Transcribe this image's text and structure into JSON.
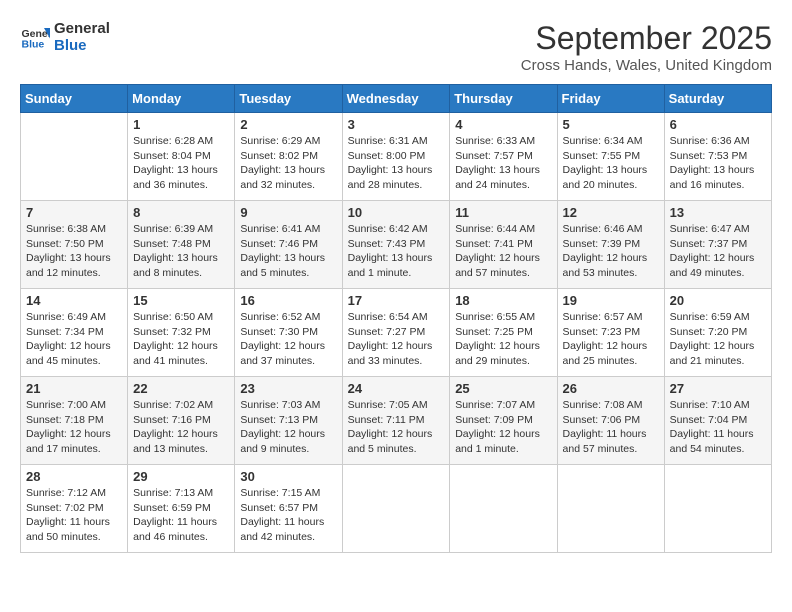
{
  "header": {
    "logo_line1": "General",
    "logo_line2": "Blue",
    "month_title": "September 2025",
    "location": "Cross Hands, Wales, United Kingdom"
  },
  "weekdays": [
    "Sunday",
    "Monday",
    "Tuesday",
    "Wednesday",
    "Thursday",
    "Friday",
    "Saturday"
  ],
  "weeks": [
    [
      {
        "day": "",
        "info": ""
      },
      {
        "day": "1",
        "info": "Sunrise: 6:28 AM\nSunset: 8:04 PM\nDaylight: 13 hours and 36 minutes."
      },
      {
        "day": "2",
        "info": "Sunrise: 6:29 AM\nSunset: 8:02 PM\nDaylight: 13 hours and 32 minutes."
      },
      {
        "day": "3",
        "info": "Sunrise: 6:31 AM\nSunset: 8:00 PM\nDaylight: 13 hours and 28 minutes."
      },
      {
        "day": "4",
        "info": "Sunrise: 6:33 AM\nSunset: 7:57 PM\nDaylight: 13 hours and 24 minutes."
      },
      {
        "day": "5",
        "info": "Sunrise: 6:34 AM\nSunset: 7:55 PM\nDaylight: 13 hours and 20 minutes."
      },
      {
        "day": "6",
        "info": "Sunrise: 6:36 AM\nSunset: 7:53 PM\nDaylight: 13 hours and 16 minutes."
      }
    ],
    [
      {
        "day": "7",
        "info": "Sunrise: 6:38 AM\nSunset: 7:50 PM\nDaylight: 13 hours and 12 minutes."
      },
      {
        "day": "8",
        "info": "Sunrise: 6:39 AM\nSunset: 7:48 PM\nDaylight: 13 hours and 8 minutes."
      },
      {
        "day": "9",
        "info": "Sunrise: 6:41 AM\nSunset: 7:46 PM\nDaylight: 13 hours and 5 minutes."
      },
      {
        "day": "10",
        "info": "Sunrise: 6:42 AM\nSunset: 7:43 PM\nDaylight: 13 hours and 1 minute."
      },
      {
        "day": "11",
        "info": "Sunrise: 6:44 AM\nSunset: 7:41 PM\nDaylight: 12 hours and 57 minutes."
      },
      {
        "day": "12",
        "info": "Sunrise: 6:46 AM\nSunset: 7:39 PM\nDaylight: 12 hours and 53 minutes."
      },
      {
        "day": "13",
        "info": "Sunrise: 6:47 AM\nSunset: 7:37 PM\nDaylight: 12 hours and 49 minutes."
      }
    ],
    [
      {
        "day": "14",
        "info": "Sunrise: 6:49 AM\nSunset: 7:34 PM\nDaylight: 12 hours and 45 minutes."
      },
      {
        "day": "15",
        "info": "Sunrise: 6:50 AM\nSunset: 7:32 PM\nDaylight: 12 hours and 41 minutes."
      },
      {
        "day": "16",
        "info": "Sunrise: 6:52 AM\nSunset: 7:30 PM\nDaylight: 12 hours and 37 minutes."
      },
      {
        "day": "17",
        "info": "Sunrise: 6:54 AM\nSunset: 7:27 PM\nDaylight: 12 hours and 33 minutes."
      },
      {
        "day": "18",
        "info": "Sunrise: 6:55 AM\nSunset: 7:25 PM\nDaylight: 12 hours and 29 minutes."
      },
      {
        "day": "19",
        "info": "Sunrise: 6:57 AM\nSunset: 7:23 PM\nDaylight: 12 hours and 25 minutes."
      },
      {
        "day": "20",
        "info": "Sunrise: 6:59 AM\nSunset: 7:20 PM\nDaylight: 12 hours and 21 minutes."
      }
    ],
    [
      {
        "day": "21",
        "info": "Sunrise: 7:00 AM\nSunset: 7:18 PM\nDaylight: 12 hours and 17 minutes."
      },
      {
        "day": "22",
        "info": "Sunrise: 7:02 AM\nSunset: 7:16 PM\nDaylight: 12 hours and 13 minutes."
      },
      {
        "day": "23",
        "info": "Sunrise: 7:03 AM\nSunset: 7:13 PM\nDaylight: 12 hours and 9 minutes."
      },
      {
        "day": "24",
        "info": "Sunrise: 7:05 AM\nSunset: 7:11 PM\nDaylight: 12 hours and 5 minutes."
      },
      {
        "day": "25",
        "info": "Sunrise: 7:07 AM\nSunset: 7:09 PM\nDaylight: 12 hours and 1 minute."
      },
      {
        "day": "26",
        "info": "Sunrise: 7:08 AM\nSunset: 7:06 PM\nDaylight: 11 hours and 57 minutes."
      },
      {
        "day": "27",
        "info": "Sunrise: 7:10 AM\nSunset: 7:04 PM\nDaylight: 11 hours and 54 minutes."
      }
    ],
    [
      {
        "day": "28",
        "info": "Sunrise: 7:12 AM\nSunset: 7:02 PM\nDaylight: 11 hours and 50 minutes."
      },
      {
        "day": "29",
        "info": "Sunrise: 7:13 AM\nSunset: 6:59 PM\nDaylight: 11 hours and 46 minutes."
      },
      {
        "day": "30",
        "info": "Sunrise: 7:15 AM\nSunset: 6:57 PM\nDaylight: 11 hours and 42 minutes."
      },
      {
        "day": "",
        "info": ""
      },
      {
        "day": "",
        "info": ""
      },
      {
        "day": "",
        "info": ""
      },
      {
        "day": "",
        "info": ""
      }
    ]
  ]
}
